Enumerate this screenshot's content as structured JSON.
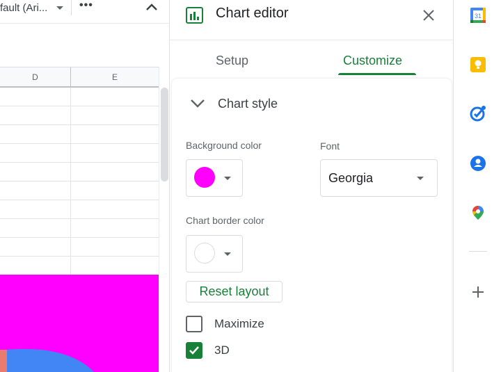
{
  "toolbar": {
    "font_select_value": "fault (Ari...",
    "more_label": "•••"
  },
  "spreadsheet": {
    "columns": [
      "D",
      "E"
    ],
    "visible_rows": 10,
    "chart_background_color": "#ff00ff"
  },
  "chart_data": {
    "type": "pie",
    "title": "",
    "background_color": "#ff00ff",
    "is_3d": true,
    "visible_slices": [
      {
        "name": "",
        "color": "#4285f4"
      },
      {
        "name": "",
        "color": "#ea7b6f"
      }
    ],
    "note": "Only a small top-left portion of the pie chart is visible; values not readable"
  },
  "editor": {
    "title": "Chart editor",
    "close_label": "×",
    "tabs": [
      {
        "label": "Setup",
        "active": false
      },
      {
        "label": "Customize",
        "active": true
      }
    ],
    "section": {
      "title": "Chart style",
      "expanded": true,
      "background_color": {
        "label": "Background color",
        "value": "#ff00ff"
      },
      "font": {
        "label": "Font",
        "value": "Georgia"
      },
      "border_color": {
        "label": "Chart border color",
        "value": "#ffffff"
      },
      "reset_label": "Reset layout",
      "checkboxes": [
        {
          "label": "Maximize",
          "checked": false
        },
        {
          "label": "3D",
          "checked": true
        }
      ]
    }
  },
  "sidebar": {
    "apps": [
      {
        "name": "Calendar",
        "icon": "calendar-icon",
        "badge": "31"
      },
      {
        "name": "Keep",
        "icon": "keep-icon"
      },
      {
        "name": "Tasks",
        "icon": "tasks-icon"
      },
      {
        "name": "Contacts",
        "icon": "contacts-icon"
      },
      {
        "name": "Maps",
        "icon": "maps-icon"
      }
    ],
    "add_label": "+"
  },
  "colors": {
    "accent_green": "#188038",
    "chart_magenta": "#ff00ff",
    "pie_blue": "#4285f4",
    "pie_red": "#ea7b6f"
  }
}
